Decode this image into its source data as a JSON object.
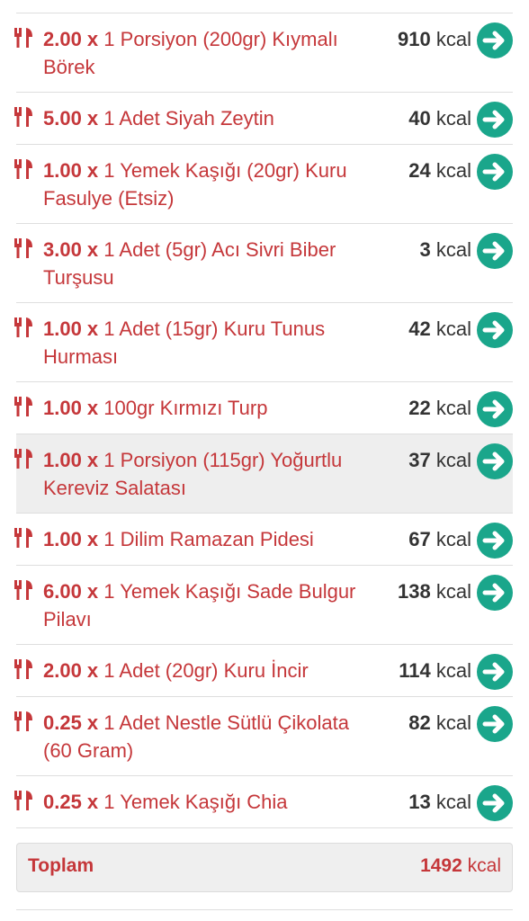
{
  "items": [
    {
      "qty": "2.00 x",
      "desc": "1 Porsiyon (200gr) Kıymalı Börek",
      "cal": "910",
      "unit": "kcal"
    },
    {
      "qty": "5.00 x",
      "desc": "1 Adet Siyah Zeytin",
      "cal": "40",
      "unit": "kcal"
    },
    {
      "qty": "1.00 x",
      "desc": "1 Yemek Kaşığı (20gr) Kuru Fasulye (Etsiz)",
      "cal": "24",
      "unit": "kcal"
    },
    {
      "qty": "3.00 x",
      "desc": "1 Adet (5gr) Acı Sivri Biber Turşusu",
      "cal": "3",
      "unit": "kcal"
    },
    {
      "qty": "1.00 x",
      "desc": "1 Adet (15gr) Kuru Tunus Hurması",
      "cal": "42",
      "unit": "kcal"
    },
    {
      "qty": "1.00 x",
      "desc": "100gr Kırmızı Turp",
      "cal": "22",
      "unit": "kcal"
    },
    {
      "qty": "1.00 x",
      "desc": "1 Porsiyon (115gr) Yoğurtlu Kereviz Salatası",
      "cal": "37",
      "unit": "kcal"
    },
    {
      "qty": "1.00 x",
      "desc": "1 Dilim Ramazan Pidesi",
      "cal": "67",
      "unit": "kcal"
    },
    {
      "qty": "6.00 x",
      "desc": "1 Yemek Kaşığı Sade Bulgur Pilavı",
      "cal": "138",
      "unit": "kcal"
    },
    {
      "qty": "2.00 x",
      "desc": "1 Adet (20gr) Kuru İncir",
      "cal": "114",
      "unit": "kcal"
    },
    {
      "qty": "0.25 x",
      "desc": "1 Adet Nestle Sütlü Çikolata (60 Gram)",
      "cal": "82",
      "unit": "kcal"
    },
    {
      "qty": "0.25 x",
      "desc": "1 Yemek Kaşığı Chia",
      "cal": "13",
      "unit": "kcal"
    }
  ],
  "total": {
    "label": "Toplam",
    "value": "1492",
    "unit": "kcal"
  },
  "colors": {
    "accent_red": "#c5373a",
    "go_green": "#1aa68b",
    "highlight": "#eeeeee"
  },
  "icons": {
    "item": "fork-knife-icon",
    "go": "arrow-right-icon"
  }
}
